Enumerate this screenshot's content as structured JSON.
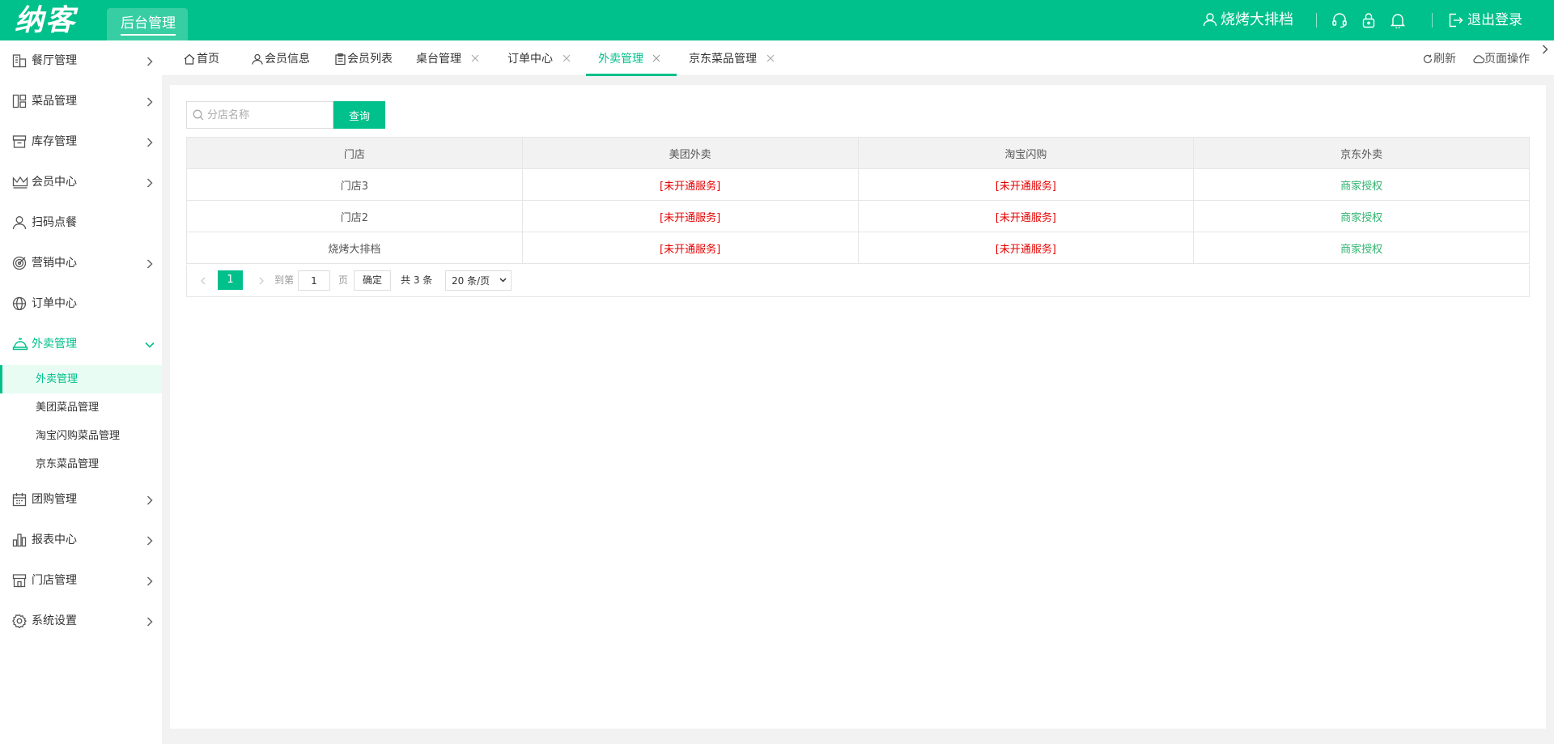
{
  "header": {
    "logo": "纳客",
    "admin_tab": "后台管理",
    "user_name": "烧烤大排档",
    "logout": "退出登录",
    "icons": [
      "user-icon",
      "headset-icon",
      "lock-icon",
      "bell-icon",
      "logout-icon"
    ]
  },
  "sidebar": {
    "items": [
      {
        "label": "餐厅管理",
        "icon": "building-icon"
      },
      {
        "label": "菜品管理",
        "icon": "layout-icon"
      },
      {
        "label": "库存管理",
        "icon": "box-icon"
      },
      {
        "label": "会员中心",
        "icon": "crown-icon"
      },
      {
        "label": "扫码点餐",
        "icon": "person-icon"
      },
      {
        "label": "营销中心",
        "icon": "target-icon"
      },
      {
        "label": "订单中心",
        "icon": "globe-icon"
      },
      {
        "label": "外卖管理",
        "icon": "bell-dish-icon",
        "expanded": true
      },
      {
        "label": "团购管理",
        "icon": "calendar-icon"
      },
      {
        "label": "报表中心",
        "icon": "bar-chart-icon"
      },
      {
        "label": "门店管理",
        "icon": "store-icon"
      },
      {
        "label": "系统设置",
        "icon": "gear-icon"
      }
    ],
    "sub_items": [
      "外卖管理",
      "美团菜品管理",
      "淘宝闪购菜品管理",
      "京东菜品管理"
    ],
    "active_sub": 0
  },
  "tabs": {
    "items": [
      {
        "label": "首页"
      },
      {
        "label": "会员信息"
      },
      {
        "label": "会员列表"
      },
      {
        "label": "桌台管理"
      },
      {
        "label": "订单中心"
      },
      {
        "label": "外卖管理"
      },
      {
        "label": "京东菜品管理"
      }
    ],
    "active": 5,
    "refresh": "刷新",
    "page_ops": "页面操作"
  },
  "search": {
    "placeholder": "分店名称",
    "button": "查询"
  },
  "table": {
    "headers": [
      "门店",
      "美团外卖",
      "淘宝闪购",
      "京东外卖"
    ],
    "rows": [
      [
        "门店3",
        "[未开通服务]",
        "[未开通服务]",
        "商家授权"
      ],
      [
        "门店2",
        "[未开通服务]",
        "[未开通服务]",
        "商家授权"
      ],
      [
        "烧烤大排档",
        "[未开通服务]",
        "[未开通服务]",
        "商家授权"
      ]
    ]
  },
  "pagination": {
    "current_page": "1",
    "goto_label": "到第",
    "goto_value": "1",
    "page_label": "页",
    "confirm": "确定",
    "total": "共 3 条",
    "page_size": "20 条/页"
  },
  "colors": {
    "brand": "#00c08b",
    "inactive_status": "#e60000",
    "authorized_status": "#2db36e"
  }
}
